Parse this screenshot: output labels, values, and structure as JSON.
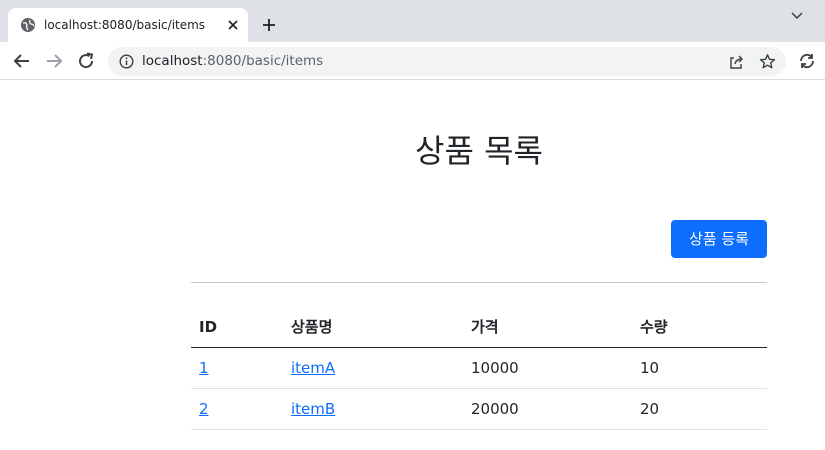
{
  "browser": {
    "tab_title": "localhost:8080/basic/items",
    "url_host": "localhost",
    "url_path": ":8080/basic/items"
  },
  "page": {
    "title": "상품 목록",
    "add_button_label": "상품 등록"
  },
  "table": {
    "headers": [
      "ID",
      "상품명",
      "가격",
      "수량"
    ],
    "rows": [
      {
        "id": "1",
        "name": "itemA",
        "price": "10000",
        "quantity": "10"
      },
      {
        "id": "2",
        "name": "itemB",
        "price": "20000",
        "quantity": "20"
      }
    ]
  },
  "colors": {
    "accent": "#0d6efd",
    "tabstrip": "#dee1e6",
    "omnibox": "#f1f3f4"
  }
}
